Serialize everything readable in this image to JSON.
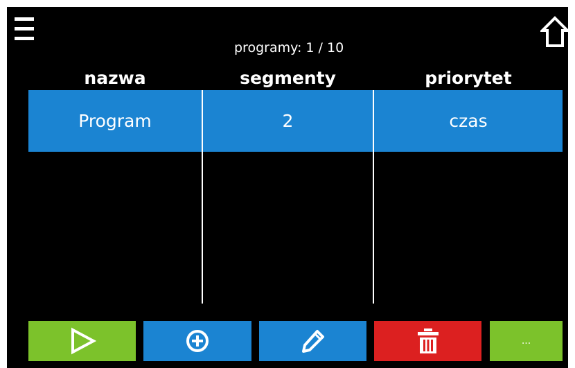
{
  "header": {
    "title": "programy: 1 / 10",
    "menu_icon": "hamburger-menu-icon",
    "home_icon": "home-icon"
  },
  "table": {
    "columns": [
      "nazwa",
      "segmenty",
      "priorytet"
    ],
    "rows": [
      {
        "name": "Program",
        "segments": "2",
        "priority": "czas"
      }
    ]
  },
  "toolbar": {
    "buttons": [
      {
        "name": "run",
        "icon": "play-icon",
        "color": "#7cc22b"
      },
      {
        "name": "add",
        "icon": "plus-circle-icon",
        "color": "#1b84d2"
      },
      {
        "name": "edit",
        "icon": "pencil-icon",
        "color": "#1b84d2"
      },
      {
        "name": "delete",
        "icon": "trash-icon",
        "color": "#dc2020"
      },
      {
        "name": "more",
        "label": "...",
        "color": "#7cc22b"
      }
    ]
  },
  "colors": {
    "screen_bg": "#000000",
    "row_selected": "#1b84d2",
    "text": "#ffffff"
  }
}
